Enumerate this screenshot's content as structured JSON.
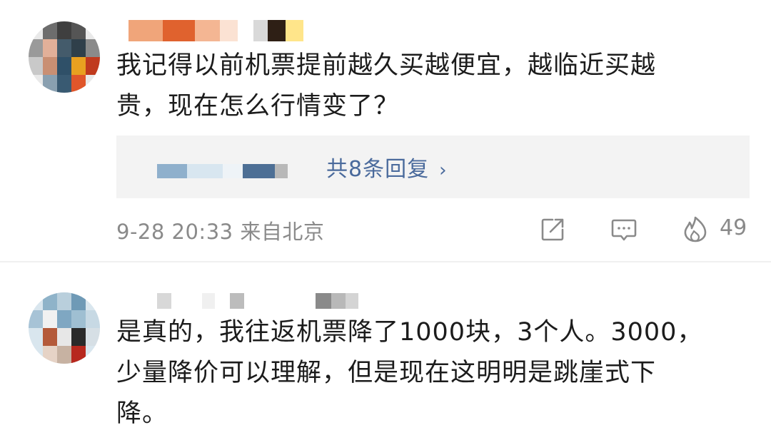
{
  "comments": [
    {
      "text_line1": "我记得以前机票提前越久买越便宜，越临近买越",
      "text_line2": "贵，现在怎么行情变了？",
      "replies_label": "共8条回复",
      "replies_chevron": "›",
      "meta": "9-28 20:33  来自北京",
      "like_count": "49",
      "icons": [
        "share-icon",
        "comment-icon",
        "like-icon"
      ]
    },
    {
      "text_line1": "是真的，我往返机票降了1000块，3个人。3000，",
      "text_line2": "少量降价可以理解，但是现在这明明是跳崖式下",
      "text_line3": "降。"
    }
  ],
  "colors": {
    "link": "#4a6a9c",
    "meta": "#8a8a8a",
    "reply_bg": "#f3f3f3"
  }
}
